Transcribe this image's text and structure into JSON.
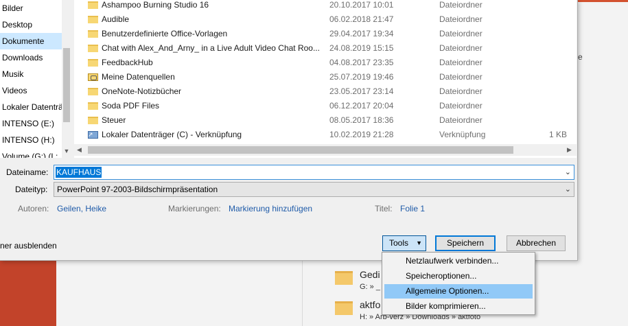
{
  "colors": {
    "accent_orange": "#d35230",
    "selection_blue": "#0078d7",
    "menu_highlight": "#91c9f7",
    "nav_selected": "#cce8ff",
    "metadata_link": "#1e5aa8"
  },
  "background": {
    "right_text": "e",
    "recent_items": [
      {
        "title": "Gedi",
        "path": "G: » _"
      },
      {
        "title": "aktfo",
        "path": "H: » Arb-verz » Downloads » aktfoto"
      }
    ]
  },
  "nav": {
    "items": [
      {
        "label": "Bilder",
        "icon": "pictures-icon"
      },
      {
        "label": "Desktop",
        "icon": "desktop-icon"
      },
      {
        "label": "Dokumente",
        "icon": "documents-icon",
        "selected": true
      },
      {
        "label": "Downloads",
        "icon": "downloads-icon"
      },
      {
        "label": "Musik",
        "icon": "music-icon"
      },
      {
        "label": "Videos",
        "icon": "videos-icon"
      },
      {
        "label": "Lokaler Datenträ",
        "icon": "drive-icon"
      },
      {
        "label": "INTENSO (E:)",
        "icon": "drive-icon"
      },
      {
        "label": "INTENSO (H:)",
        "icon": "drive-icon"
      },
      {
        "label": "Volume (G:) (L:",
        "icon": "drive-icon"
      }
    ]
  },
  "files": [
    {
      "name": "Ashampoo Burning Studio 16",
      "date": "20.10.2017 10:01",
      "type": "Dateiordner",
      "size": "",
      "icon": "folder-icon"
    },
    {
      "name": "Audible",
      "date": "06.02.2018 21:47",
      "type": "Dateiordner",
      "size": "",
      "icon": "folder-icon"
    },
    {
      "name": "Benutzerdefinierte Office-Vorlagen",
      "date": "29.04.2017 19:34",
      "type": "Dateiordner",
      "size": "",
      "icon": "folder-icon"
    },
    {
      "name": "Chat with Alex_And_Arny_ in a Live Adult Video Chat Roo...",
      "date": "24.08.2019 15:15",
      "type": "Dateiordner",
      "size": "",
      "icon": "folder-icon"
    },
    {
      "name": "FeedbackHub",
      "date": "04.08.2017 23:35",
      "type": "Dateiordner",
      "size": "",
      "icon": "folder-icon"
    },
    {
      "name": "Meine Datenquellen",
      "date": "25.07.2019 19:46",
      "type": "Dateiordner",
      "size": "",
      "icon": "data-sources-folder-icon"
    },
    {
      "name": "OneNote-Notizbücher",
      "date": "23.05.2017 23:14",
      "type": "Dateiordner",
      "size": "",
      "icon": "folder-icon"
    },
    {
      "name": "Soda PDF Files",
      "date": "06.12.2017 20:04",
      "type": "Dateiordner",
      "size": "",
      "icon": "folder-icon"
    },
    {
      "name": "Steuer",
      "date": "08.05.2017 18:36",
      "type": "Dateiordner",
      "size": "",
      "icon": "folder-icon"
    },
    {
      "name": "Lokaler Datenträger (C) - Verknüpfung",
      "date": "10.02.2019 21:28",
      "type": "Verknüpfung",
      "size": "1 KB",
      "icon": "shortcut-icon"
    }
  ],
  "form": {
    "filename_label": "Dateiname:",
    "filename_value": "KAUFHAUS",
    "filetype_label": "Dateityp:",
    "filetype_value": "PowerPoint 97-2003-Bildschirmpräsentation",
    "authors_label": "Autoren:",
    "authors_value": "Geilen, Heike",
    "tags_label": "Markierungen:",
    "tags_value": "Markierung hinzufügen",
    "title_label": "Titel:",
    "title_value": "Folie 1"
  },
  "footer": {
    "hide_folders_label": "ner ausblenden",
    "tools_label": "Tools",
    "save_label": "Speichern",
    "cancel_label": "Abbrechen"
  },
  "tools_menu": {
    "items": [
      {
        "label": "Netzlaufwerk verbinden..."
      },
      {
        "label": "Speicheroptionen..."
      },
      {
        "label": "Allgemeine Optionen...",
        "highlighted": true
      },
      {
        "label": "Bilder komprimieren..."
      }
    ]
  }
}
